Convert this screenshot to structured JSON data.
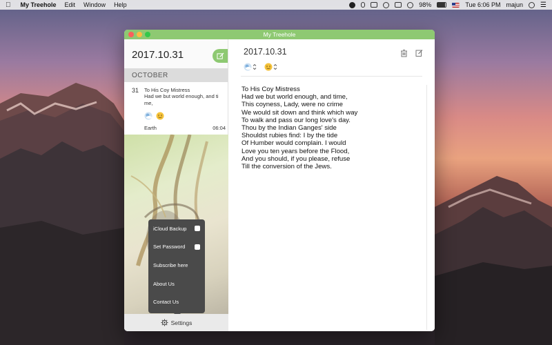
{
  "menubar": {
    "app_name": "My Treehole",
    "menus": [
      "Edit",
      "Window",
      "Help"
    ],
    "battery": "98%",
    "clock": "Tue 6:06 PM",
    "user": "majun"
  },
  "window": {
    "title": "My Treehole"
  },
  "sidebar": {
    "date": "2017.10.31",
    "month": "OCTOBER",
    "entry": {
      "day": "31",
      "title": "To His Coy Mistress",
      "preview": "Had we but world enough, and ti me,",
      "location": "Earth",
      "time": "06:04"
    },
    "settings_label": "Settings",
    "popup": [
      {
        "label": "iCloud Backup",
        "has_check": true
      },
      {
        "label": "Set Password",
        "has_check": true
      },
      {
        "label": "Subscribe here",
        "has_check": false
      },
      {
        "label": "About Us",
        "has_check": false
      },
      {
        "label": "Contact Us",
        "has_check": false
      }
    ]
  },
  "main": {
    "date": "2017.10.31",
    "lines": [
      "To His Coy Mistress",
      "Had we but world enough, and time,",
      "This coyness, Lady, were no crime",
      "We would sit down and think which way",
      "To walk and pass our long love's day.",
      "Thou by the Indian Ganges' side",
      "Shouldst rubies find: I by the tide",
      "Of Humber would complain. I would",
      "Love you ten years before the Flood,",
      "And you should, if you please, refuse",
      "Till the conversion of the Jews."
    ]
  },
  "colors": {
    "accent": "#8ec972",
    "popup_bg": "#4a4a4a"
  },
  "icons": [
    "apple-icon",
    "compose-icon",
    "trash-icon",
    "weather-icon",
    "mood-icon",
    "gear-icon"
  ]
}
